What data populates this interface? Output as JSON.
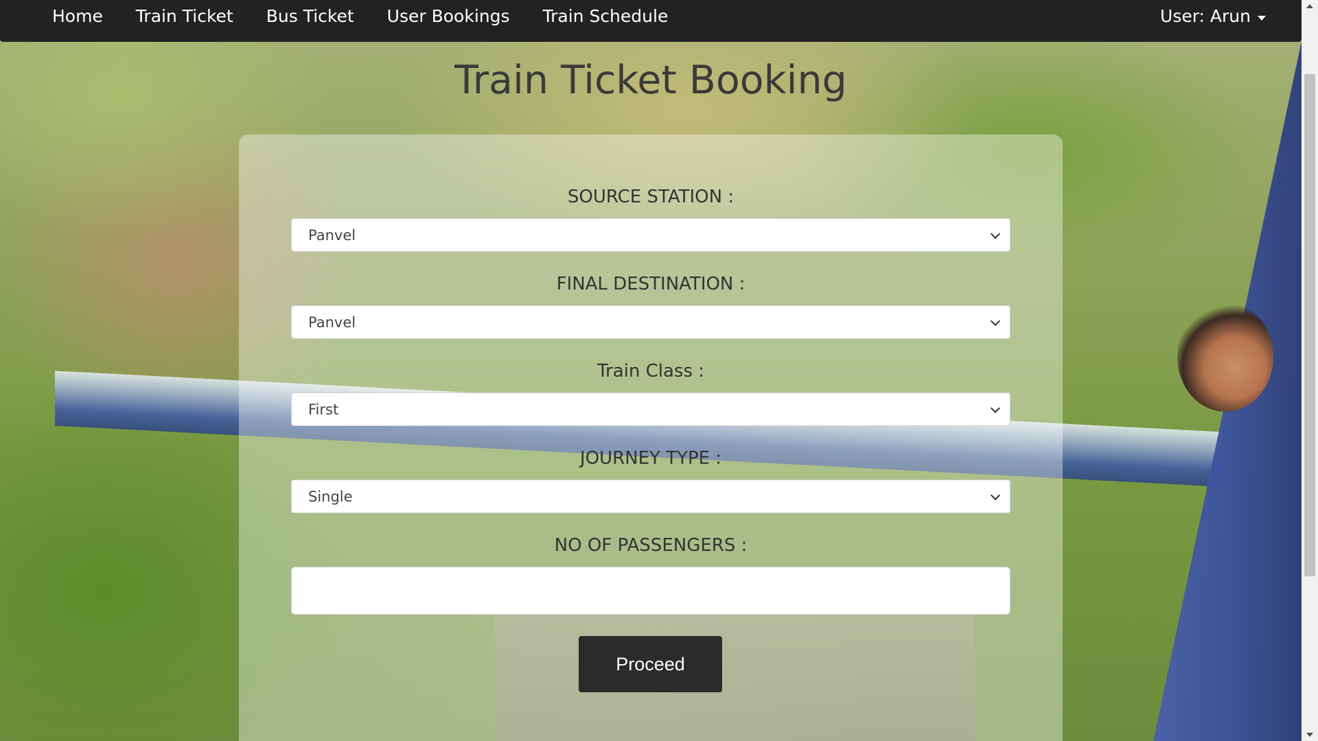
{
  "nav": {
    "links": [
      "Home",
      "Train Ticket",
      "Bus Ticket",
      "User Bookings",
      "Train Schedule"
    ],
    "user_label": "User: Arun"
  },
  "page": {
    "title": "Train Ticket Booking"
  },
  "form": {
    "source_label": "SOURCE STATION :",
    "source_value": "Panvel",
    "destination_label": "FINAL DESTINATION :",
    "destination_value": "Panvel",
    "class_label": "Train Class :",
    "class_value": "First",
    "journey_label": "JOURNEY TYPE :",
    "journey_value": "Single",
    "passengers_label": "NO OF PASSENGERS :",
    "passengers_value": "",
    "proceed_label": "Proceed"
  }
}
